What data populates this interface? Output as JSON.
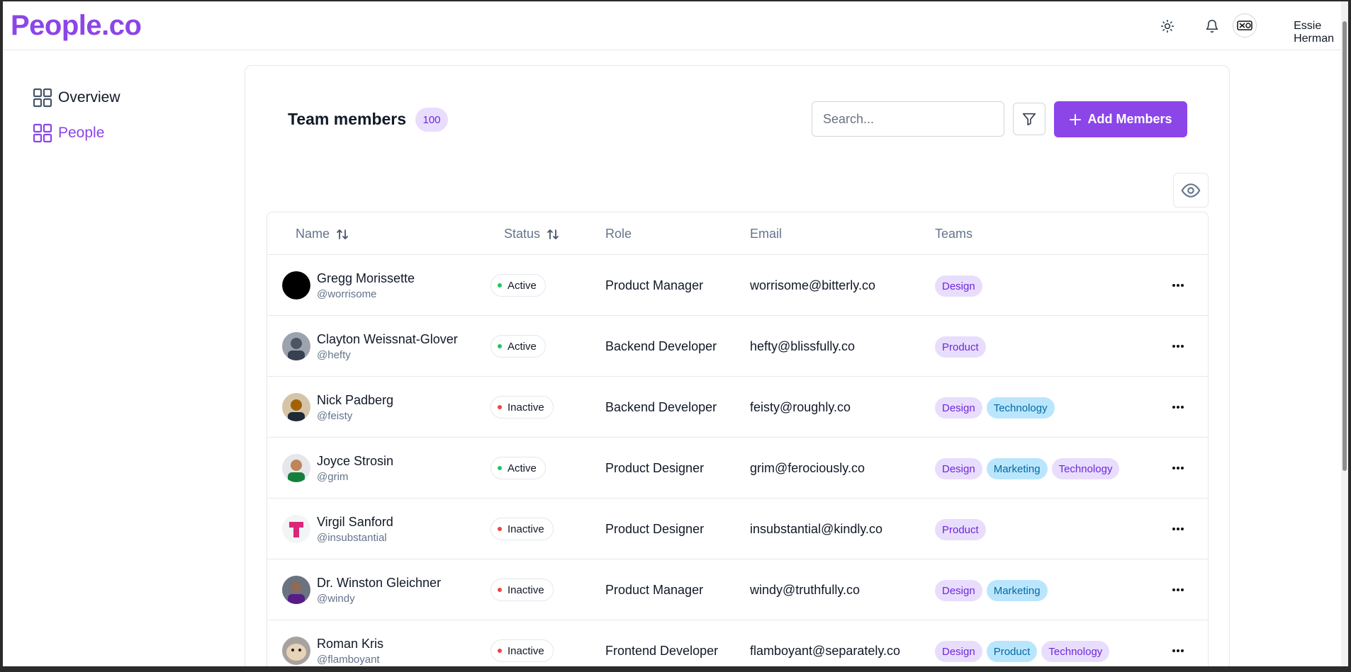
{
  "app": {
    "logo": "People.co"
  },
  "header": {
    "user_name": "Essie Herman"
  },
  "sidebar": {
    "items": [
      {
        "label": "Overview",
        "active": false
      },
      {
        "label": "People",
        "active": true
      }
    ]
  },
  "main": {
    "title": "Team members",
    "count": "100",
    "search_placeholder": "Search...",
    "add_label": "Add Members",
    "columns": {
      "name": "Name",
      "status": "Status",
      "role": "Role",
      "email": "Email",
      "teams": "Teams"
    }
  },
  "colors": {
    "accent": "#8b45e8",
    "active_dot": "#22c55e",
    "inactive_dot": "#ef4444",
    "tag_purple_bg": "#e9ddfd",
    "tag_purple_fg": "#6d28d9",
    "tag_blue_bg": "#bae6fd",
    "tag_blue_fg": "#0369a1"
  },
  "members": [
    {
      "name": "Gregg Morissette",
      "handle": "@worrisome",
      "status": "Active",
      "role": "Product Manager",
      "email": "worrisome@bitterly.co",
      "teams": [
        "Design"
      ],
      "avatar": "black-circle"
    },
    {
      "name": "Clayton Weissnat-Glover",
      "handle": "@hefty",
      "status": "Active",
      "role": "Backend Developer",
      "email": "hefty@blissfully.co",
      "teams": [
        "Product"
      ],
      "avatar": "photo-grey"
    },
    {
      "name": "Nick Padberg",
      "handle": "@feisty",
      "status": "Inactive",
      "role": "Backend Developer",
      "email": "feisty@roughly.co",
      "teams": [
        "Design",
        "Technology"
      ],
      "avatar": "photo-tan"
    },
    {
      "name": "Joyce Strosin",
      "handle": "@grim",
      "status": "Active",
      "role": "Product Designer",
      "email": "grim@ferociously.co",
      "teams": [
        "Design",
        "Marketing",
        "Technology"
      ],
      "avatar": "photo-green"
    },
    {
      "name": "Virgil Sanford",
      "handle": "@insubstantial",
      "status": "Inactive",
      "role": "Product Designer",
      "email": "insubstantial@kindly.co",
      "teams": [
        "Product"
      ],
      "avatar": "pink-shirt"
    },
    {
      "name": "Dr. Winston Gleichner",
      "handle": "@windy",
      "status": "Inactive",
      "role": "Product Manager",
      "email": "windy@truthfully.co",
      "teams": [
        "Design",
        "Marketing"
      ],
      "avatar": "photo-purple"
    },
    {
      "name": "Roman Kris",
      "handle": "@flamboyant",
      "status": "Inactive",
      "role": "Frontend Developer",
      "email": "flamboyant@separately.co",
      "teams": [
        "Design",
        "Product",
        "Technology"
      ],
      "avatar": "photo-hamster"
    }
  ]
}
